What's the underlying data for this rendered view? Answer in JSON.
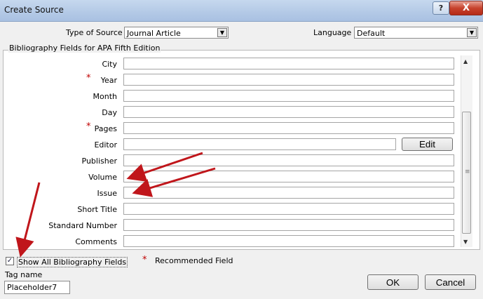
{
  "window": {
    "title": "Create Source",
    "help": "?",
    "close": "X"
  },
  "source_type": {
    "label": "Type of Source",
    "value": "Journal Article"
  },
  "language": {
    "label": "Language",
    "value": "Default"
  },
  "group": {
    "title": "Bibliography Fields for APA Fifth Edition"
  },
  "fields": [
    {
      "label": "City",
      "required": false,
      "value": ""
    },
    {
      "label": "Year",
      "required": true,
      "value": ""
    },
    {
      "label": "Month",
      "required": false,
      "value": ""
    },
    {
      "label": "Day",
      "required": false,
      "value": ""
    },
    {
      "label": "Pages",
      "required": true,
      "value": ""
    },
    {
      "label": "Editor",
      "required": false,
      "value": ""
    },
    {
      "label": "Publisher",
      "required": false,
      "value": ""
    },
    {
      "label": "Volume",
      "required": false,
      "value": ""
    },
    {
      "label": "Issue",
      "required": false,
      "value": ""
    },
    {
      "label": "Short Title",
      "required": false,
      "value": ""
    },
    {
      "label": "Standard Number",
      "required": false,
      "value": ""
    },
    {
      "label": "Comments",
      "required": false,
      "value": ""
    }
  ],
  "required_marker": "*",
  "edit_button": "Edit",
  "show_all": {
    "label": "Show All Bibliography Fields",
    "checked": true,
    "check_mark": "✓"
  },
  "legend": {
    "marker": "*",
    "text": "Recommended Field"
  },
  "tag_name": {
    "label": "Tag name",
    "value": "Placeholder7"
  },
  "buttons": {
    "ok": "OK",
    "cancel": "Cancel"
  },
  "annotation_color": "#c0161b"
}
